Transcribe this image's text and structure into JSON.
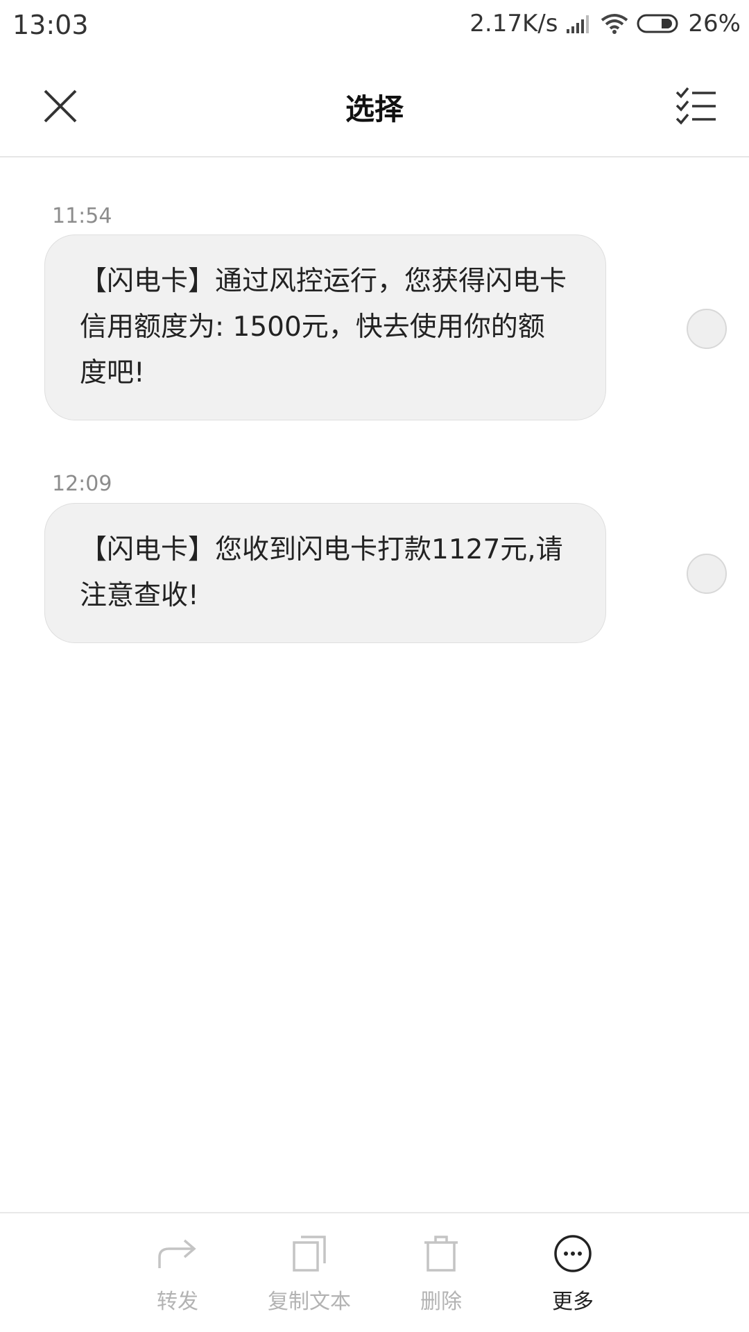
{
  "status_bar": {
    "time": "13:03",
    "network_speed": "2.17K/s",
    "battery": "26%"
  },
  "header": {
    "title": "选择",
    "close_icon": "close-icon",
    "select_all_icon": "select-all-icon"
  },
  "messages": [
    {
      "time": "11:54",
      "text": "【闪电卡】通过风控运行，您获得闪电卡信用额度为: 1500元，快去使用你的额度吧!"
    },
    {
      "time": "12:09",
      "text": "【闪电卡】您收到闪电卡打款1127元,请注意查收!"
    }
  ],
  "actions": [
    {
      "label": "转发",
      "icon": "forward-icon",
      "enabled": false
    },
    {
      "label": "复制文本",
      "icon": "copy-icon",
      "enabled": false
    },
    {
      "label": "删除",
      "icon": "trash-icon",
      "enabled": false
    },
    {
      "label": "更多",
      "icon": "more-icon",
      "enabled": true
    }
  ],
  "colors": {
    "bubble_bg": "#f1f1f1",
    "disabled_text": "#b3b3b3",
    "active_text": "#222222"
  }
}
